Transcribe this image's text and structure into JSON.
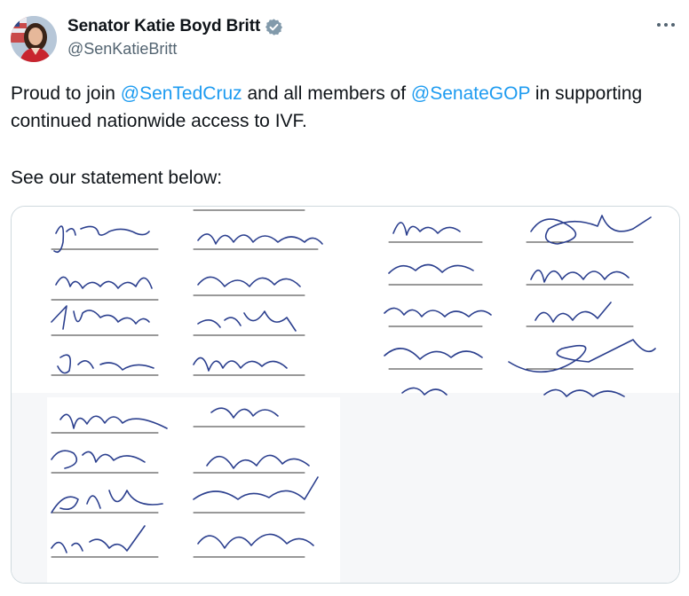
{
  "author": {
    "display_name": "Senator Katie Boyd Britt",
    "handle": "@SenKatieBritt",
    "verified": true,
    "avatar": "portrait-avatar",
    "verified_color": "#829aab"
  },
  "more_menu_icon": "ellipsis-icon",
  "tweet": {
    "text_before": "Proud to join ",
    "mention_1": "@SenTedCruz",
    "text_middle": " and all members of ",
    "mention_2": "@SenateGOP",
    "text_after": " in supporting continued nationwide access to IVF.",
    "paragraph_2": "See our statement below:",
    "mention_color": "#1d9bf0"
  },
  "media": {
    "kind": "signatures-image",
    "ink_color": "#2b3f8e",
    "border_color": "#cfd9de"
  }
}
